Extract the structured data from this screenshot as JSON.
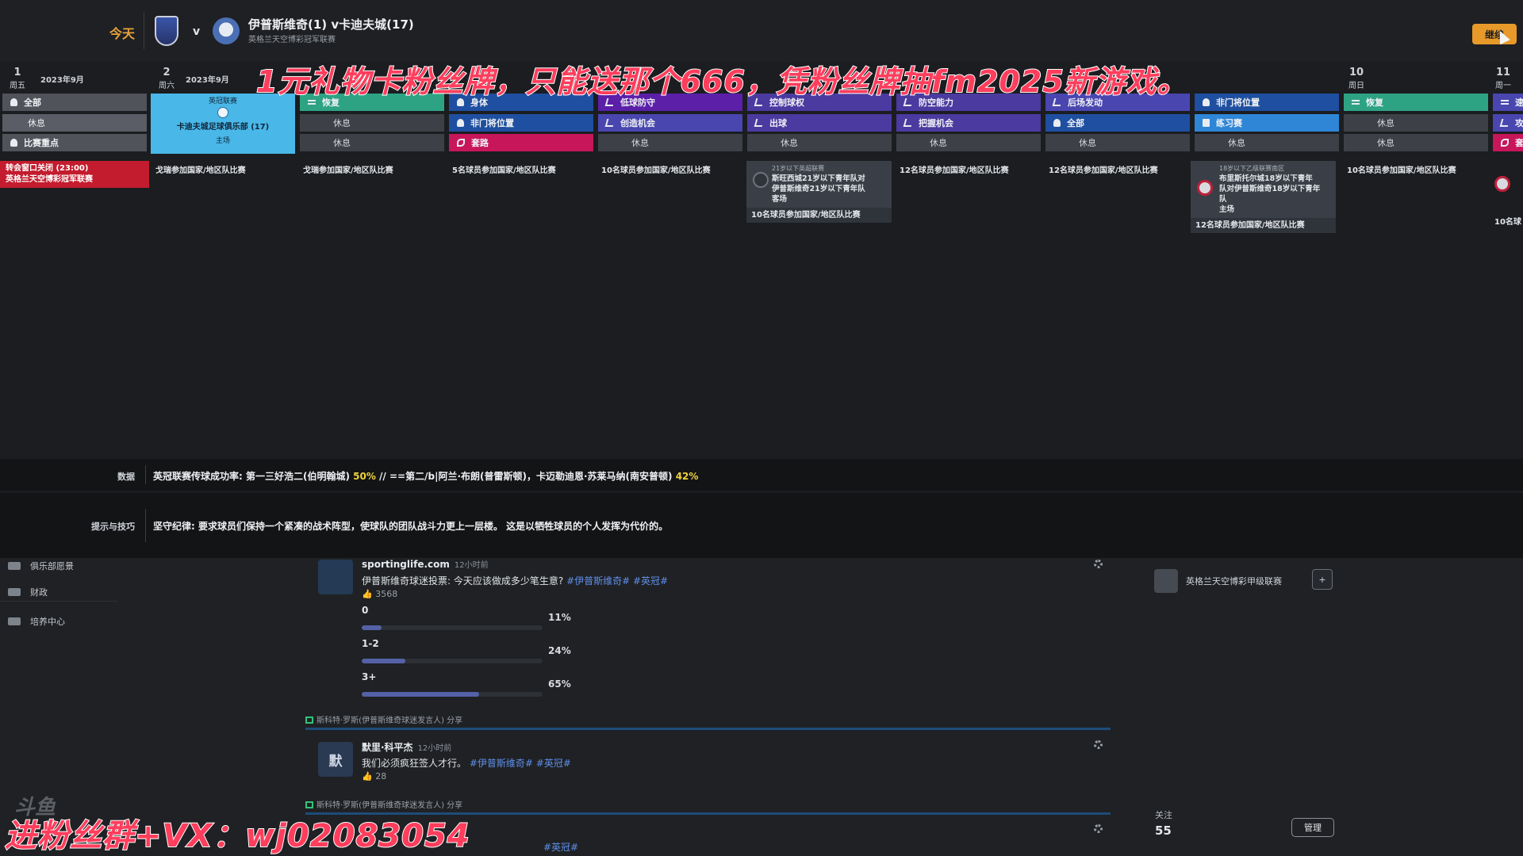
{
  "header": {
    "today": "今天",
    "vs": "v",
    "match_title": "伊普斯维奇(1) v卡迪夫城(17)",
    "match_subtitle": "英格兰天空博彩冠军联赛",
    "continue_label": "继续"
  },
  "overlay": {
    "top_banner": "1元礼物卡粉丝牌，只能送那个666，凭粉丝牌抽fm2025新游戏。",
    "bottom_banner": "进粉丝群+VX：wj02083054",
    "watermark": "斗鱼"
  },
  "calendar": {
    "days": [
      {
        "num": "1",
        "wd": "周五"
      },
      {
        "num": "2",
        "wd": "周六"
      },
      {
        "num": "10",
        "wd": "周日"
      },
      {
        "num": "11",
        "wd": "周一"
      }
    ],
    "months": [
      "2023年9月",
      "2023年9月"
    ],
    "day1": {
      "slots": [
        "全部",
        "休息",
        "比赛重点"
      ],
      "deadline": [
        "转会窗口关闭 (23:00)",
        "英格兰天空博彩冠军联赛"
      ]
    },
    "match_cell": {
      "league": "英冠联赛",
      "opponent": "卡迪夫城足球俱乐部 (17)",
      "venue": "主场"
    },
    "columns": [
      {
        "slots": [
          "恢复",
          "休息",
          "休息"
        ],
        "info": "戈瑞参加国家/地区队比赛"
      },
      {
        "slots": [
          "身体",
          "非门将位置",
          "套路"
        ],
        "info": "5名球员参加国家/地区队比赛"
      },
      {
        "slots": [
          "低球防守",
          "创造机会",
          "休息"
        ],
        "info": "10名球员参加国家/地区队比赛"
      },
      {
        "slots": [
          "控制球权",
          "出球",
          "休息"
        ],
        "fixture": {
          "head": "21岁以下英超联赛",
          "body": [
            "斯旺西城21岁以下青年队对",
            "伊普斯维奇21岁以下青年队",
            "客场"
          ],
          "foot": "10名球员参加国家/地区队比赛"
        }
      },
      {
        "slots": [
          "防空能力",
          "把握机会",
          "休息"
        ],
        "info": "12名球员参加国家/地区队比赛"
      },
      {
        "slots": [
          "后场发动",
          "全部",
          "休息"
        ],
        "info": "12名球员参加国家/地区队比赛"
      },
      {
        "slots": [
          "非门将位置",
          "练习赛",
          "休息"
        ],
        "fixture": {
          "head": "18岁以下乙级联赛南区",
          "body": [
            "布里斯托尔城18岁以下青年",
            "队对伊普斯维奇18岁以下青年",
            "队",
            "主场"
          ],
          "foot": "12名球员参加国家/地区队比赛"
        }
      },
      {
        "slots": [
          "恢复",
          "休息",
          "休息"
        ],
        "info": "10名球员参加国家/地区队比赛"
      },
      {
        "slots": [
          "速",
          "攻",
          "套"
        ],
        "info": "10名球"
      }
    ],
    "first_info": "戈瑞参加国家/地区队比赛"
  },
  "stats": {
    "label": "数据",
    "text_a": "英冠联赛传球成功率: 第一三好浩二(伯明翰城) ",
    "hl_a": "50%",
    "text_b": " // ==第二/b|阿兰·布朗(普雷斯顿)，卡迈勒迪恩·苏莱马纳(南安普顿) ",
    "hl_b": "42%"
  },
  "tips": {
    "label": "提示与技巧",
    "text": "坚守纪律: 要求球员们保持一个紧凑的战术阵型，使球队的团队战斗力更上一层楼。 这是以牺牲球员的个人发挥为代价的。"
  },
  "sidebar": {
    "items": [
      "俱乐部愿景",
      "财政",
      "培养中心"
    ]
  },
  "feed": {
    "post1": {
      "author": "sportinglife.com",
      "time": "12小时前",
      "text": "伊普斯维奇球迷投票: 今天应该做成多少笔生意?",
      "tags": "#伊普斯维奇# #英冠#",
      "likes": "3568",
      "poll": [
        {
          "label": "0",
          "pct": "11%",
          "value": 11
        },
        {
          "label": "1-2",
          "pct": "24%",
          "value": 24
        },
        {
          "label": "3+",
          "pct": "65%",
          "value": 65
        }
      ]
    },
    "share1": "斯科特·罗斯(伊普斯维奇球迷发言人) 分享",
    "post2": {
      "avatar": "默",
      "author": "默里·科平杰",
      "time": "12小时前",
      "text": "我们必须疯狂签人才行。",
      "tags": "#伊普斯维奇# #英冠#",
      "likes": "28"
    },
    "share2": "斯科特·罗斯(伊普斯维奇球迷发言人) 分享",
    "post3_tags": "#英冠#"
  },
  "right_panel": {
    "league": "英格兰天空博彩甲级联赛",
    "follow_label": "关注",
    "follow_count": "55",
    "manage_label": "管理"
  },
  "colors": {
    "accent": "#e79a2a",
    "match": "#49b7e8",
    "deadline": "#c31c2e",
    "highlight": "#f0d23a"
  }
}
